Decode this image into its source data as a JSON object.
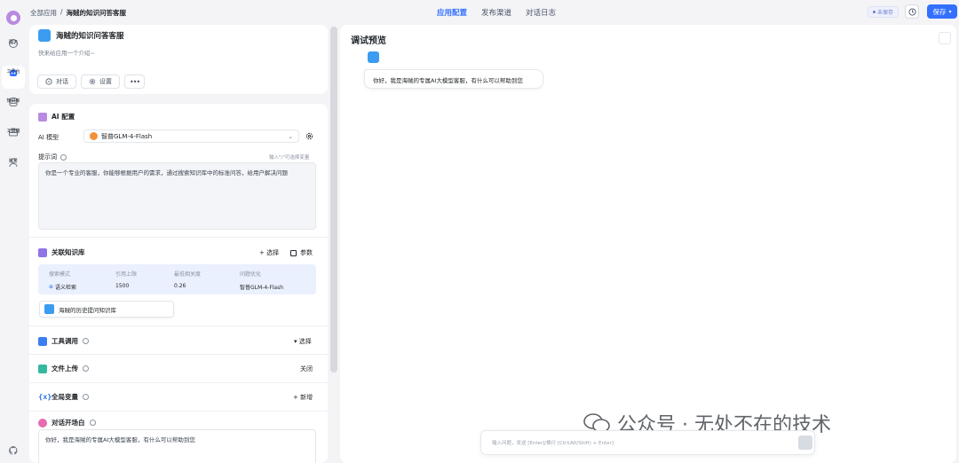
{
  "rail": {
    "items": [
      {
        "label": "聊天",
        "icon": "chat-icon"
      },
      {
        "label": "工作台",
        "icon": "workbench-icon",
        "active": true
      },
      {
        "label": "知识库",
        "icon": "database-icon"
      },
      {
        "label": "工具箱",
        "icon": "toolbox-icon"
      },
      {
        "label": "账号",
        "icon": "user-icon"
      }
    ]
  },
  "header": {
    "breadcrumb_root": "全部应用",
    "breadcrumb_sep": "/",
    "breadcrumb_current": "海贼的知识问答客服",
    "tabs": [
      "应用配置",
      "发布渠道",
      "对话日志"
    ],
    "unsaved": "未保存",
    "save_label": "保存"
  },
  "app": {
    "name": "海贼的知识问答客服",
    "intro": "快来给应用一个介绍~",
    "chat_btn": "对话",
    "settings_btn": "设置"
  },
  "ai_config": {
    "title": "AI 配置",
    "model_label": "AI 模型",
    "model_value": "智普GLM-4-Flash",
    "prompt_label": "提示词",
    "prompt_hint": "输入\"/\"可选择变量",
    "prompt_text": "你是一个专业的客服，你能够根据用户的需求，通过搜索知识库中的标准问答，给用户解决问题"
  },
  "knowledge": {
    "title": "关联知识库",
    "select_btn": "+ 选择",
    "param_btn": "参数",
    "headers": [
      "搜索模式",
      "引用上限",
      "最低相关度",
      "问题优化"
    ],
    "row": [
      "语义检索",
      "1500",
      "0.26",
      "智普GLM-4-Flash"
    ],
    "kb_name": "海贼的历史提问知识库"
  },
  "tools": {
    "title": "工具调用",
    "action": "▾ 选择"
  },
  "file_upload": {
    "title": "文件上传",
    "action": "关闭"
  },
  "globals": {
    "title": "全局变量",
    "action": "+ 新增"
  },
  "opener": {
    "title": "对话开场白",
    "text": "你好，我是海贼的专属AI大模型客服，有什么可以帮助到您"
  },
  "preview": {
    "title": "调试预览",
    "bot_message": "你好，我是海贼的专属AI大模型客服，有什么可以帮助到您",
    "input_placeholder": "输入问题，发送 [Enter]/换行 [Ctrl(Alt/Shift) + Enter]"
  },
  "watermark": {
    "text": "公众号 · 无处不在的技术"
  },
  "colors": {
    "accent": "#3370ff",
    "avatar": "#b98be0",
    "kb_table_bg": "#eaf0fd"
  }
}
